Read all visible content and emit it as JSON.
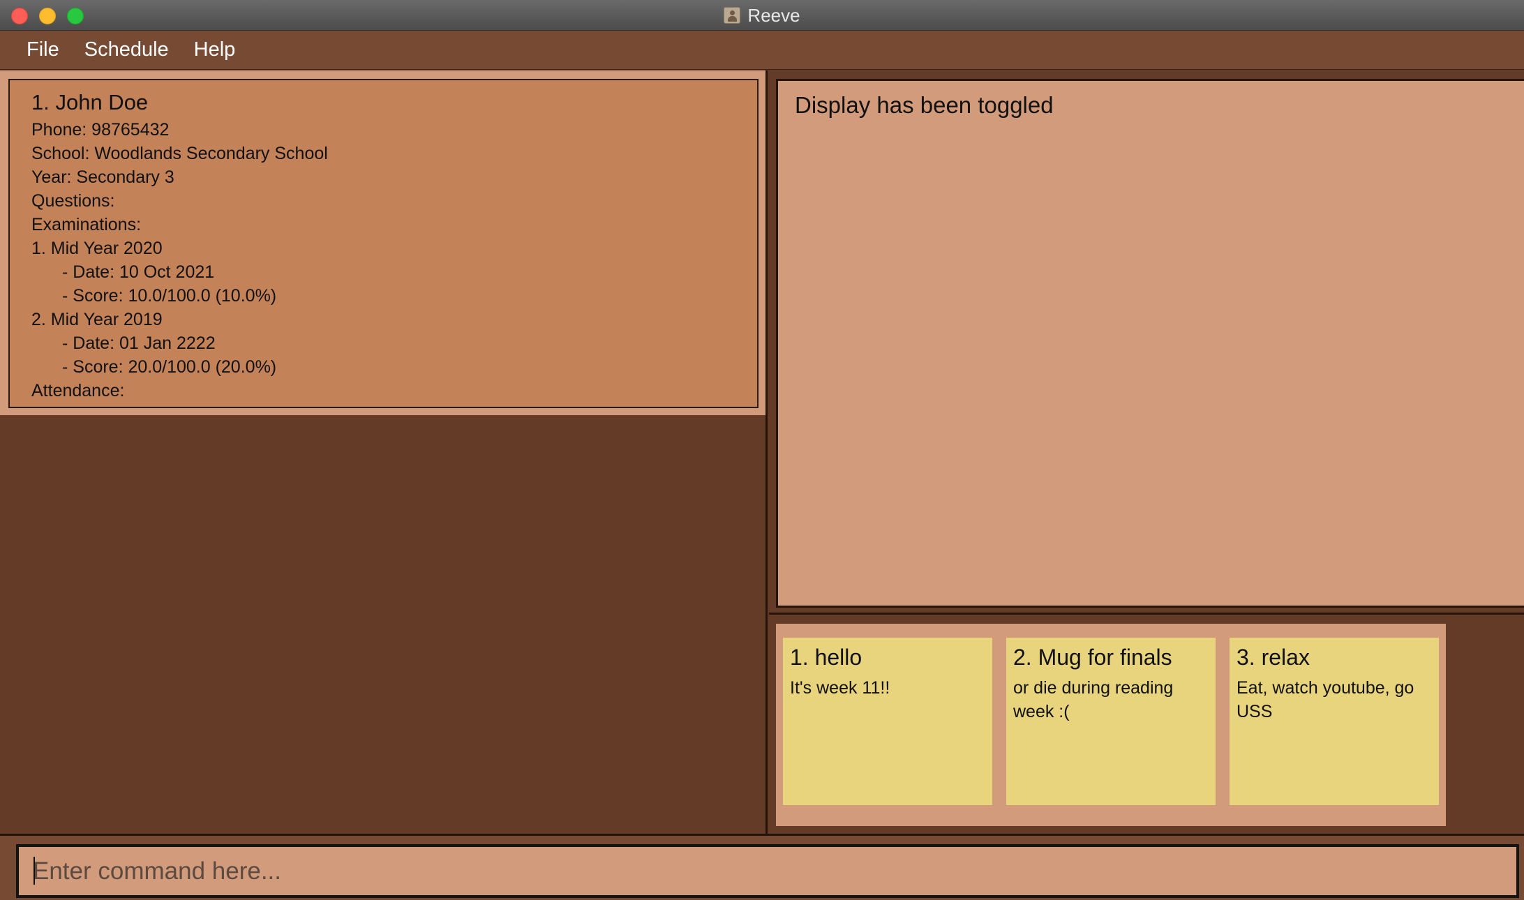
{
  "window": {
    "title": "Reeve",
    "icon": "app-person-icon"
  },
  "menu": {
    "items": [
      "File",
      "Schedule",
      "Help"
    ]
  },
  "student": {
    "index_name": "1.  John Doe",
    "phone": "Phone: 98765432",
    "school": "School: Woodlands Secondary School",
    "year": "Year: Secondary 3",
    "questions": "Questions:",
    "examinations": "Examinations:",
    "exams": [
      {
        "title": "1. Mid Year 2020",
        "date": "- Date: 10 Oct 2021",
        "score": "- Score: 10.0/100.0 (10.0%)"
      },
      {
        "title": "2. Mid Year 2019",
        "date": "- Date: 01 Jan 2222",
        "score": "- Score: 20.0/100.0 (20.0%)"
      }
    ],
    "attendance": "Attendance:"
  },
  "result": {
    "message": "Display has been toggled"
  },
  "notes": [
    {
      "title": "1. hello",
      "body": "It's week 11!!"
    },
    {
      "title": "2. Mug for finals",
      "body": "or die during reading week :("
    },
    {
      "title": "3. relax",
      "body": "Eat, watch youtube, go USS"
    }
  ],
  "command": {
    "placeholder": "Enter command here...",
    "value": ""
  },
  "colors": {
    "menu_bg": "#774a34",
    "panel_bg": "#633b26",
    "card_bg": "#c48259",
    "light_bg": "#d29b7b",
    "note_bg": "#e8d47d"
  }
}
